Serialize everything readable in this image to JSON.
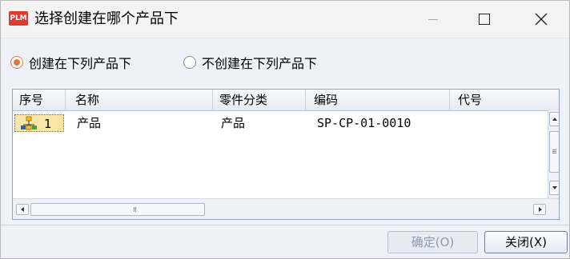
{
  "window": {
    "app_icon_text": "PLM",
    "title": "选择创建在哪个产品下"
  },
  "options": {
    "create_under": "创建在下列产品下",
    "not_create_under": "不创建在下列产品下",
    "selected": "create_under"
  },
  "grid": {
    "columns": [
      "序号",
      "名称",
      "零件分类",
      "编码",
      "代号"
    ],
    "rows": [
      {
        "index": "1",
        "name": "产品",
        "category": "产品",
        "code": "SP-CP-01-0010",
        "alias": ""
      }
    ]
  },
  "buttons": {
    "ok": "确定(O)",
    "close": "关闭(X)"
  },
  "colors": {
    "accent_radio": "#e8763a",
    "selected_cell": "#fbe6a8",
    "app_icon": "#e03a2e"
  }
}
